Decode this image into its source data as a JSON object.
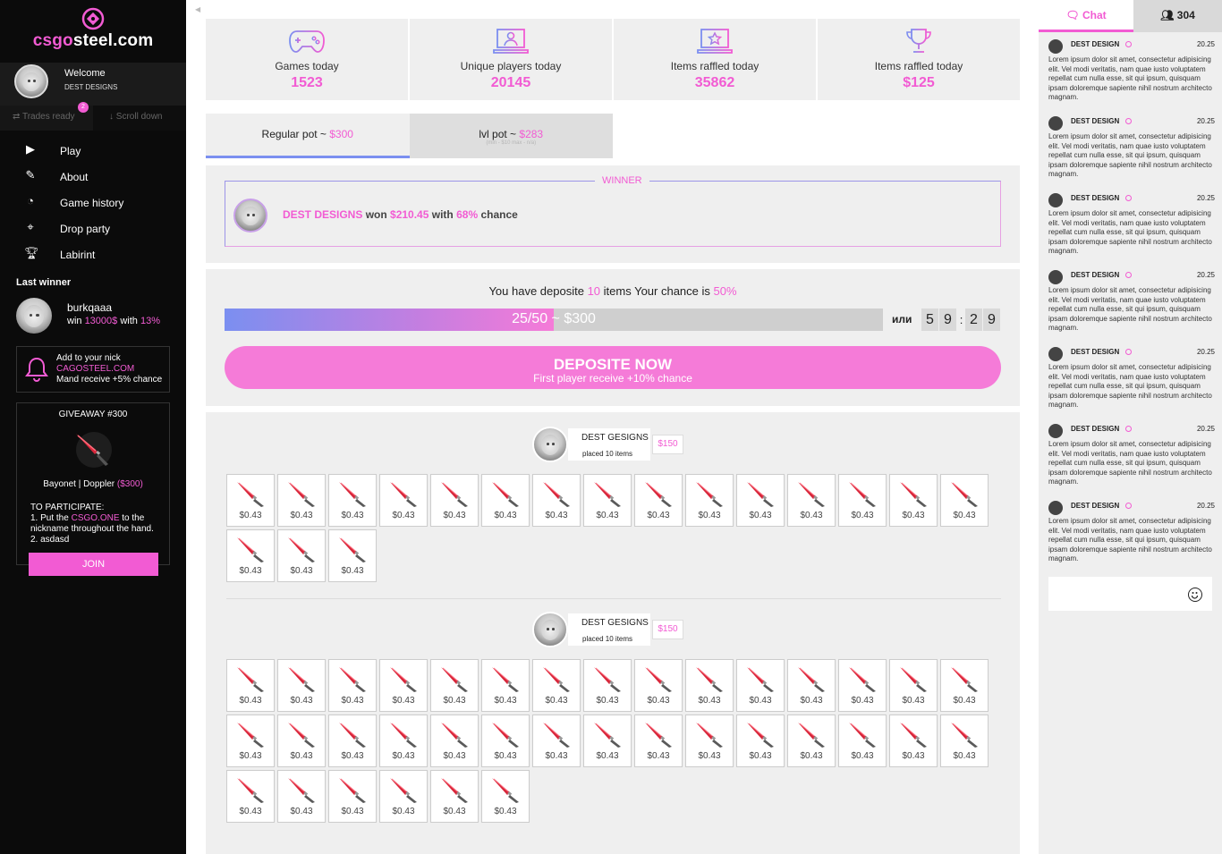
{
  "sidebar": {
    "logo": {
      "pre": "csgo",
      "post": "steel.com"
    },
    "welcome": "Welcome",
    "username": "DEST DESIGNS",
    "tab_trades": "Trades ready",
    "trades_count": "2",
    "tab_scroll": "Scroll down",
    "nav": [
      {
        "label": "Play",
        "icon": "play-icon"
      },
      {
        "label": "About",
        "icon": "edit-icon"
      },
      {
        "label": "Game history",
        "icon": "clock-icon"
      },
      {
        "label": "Drop party",
        "icon": "crosshair-icon"
      },
      {
        "label": "Labirint",
        "icon": "trophy-icon"
      }
    ],
    "last_winner": {
      "title": "Last winner",
      "name": "burkqaaa",
      "win_pre": "win ",
      "amount": "13000$",
      "with": " with ",
      "chance": "13%"
    },
    "promo": {
      "line1": "Add to your nick",
      "site": "CAGOSTEEL.COM",
      "line3": "Mand receive +5% chance"
    },
    "giveaway": {
      "title": "GIVEAWAY #300",
      "item": "Bayonet | Doppler ",
      "price": "($300)",
      "participate": "TO PARTICIPATE:",
      "step1_pre": "1. Put the ",
      "step1_site": "CSGO.ONE",
      "step1_post": " to the nickname throughout the hand.",
      "step2": "2. asdasd",
      "join": "JOIN"
    }
  },
  "stats": [
    {
      "label": "Games today",
      "value": "1523",
      "icon": "gamepad-icon"
    },
    {
      "label": "Unique players today",
      "value": "20145",
      "icon": "user-screen-icon"
    },
    {
      "label": "Items raffled today",
      "value": "35862",
      "icon": "star-screen-icon"
    },
    {
      "label": "Items raffled today",
      "value": "$125",
      "icon": "trophy-icon"
    }
  ],
  "pots": {
    "regular_label": "Regular pot ~ ",
    "regular_value": "$300",
    "lvl_label": "lvl pot ~ ",
    "lvl_value": "$283",
    "lvl_sub": "(min - $10 max - n/a)"
  },
  "winner": {
    "label": "WINNER",
    "name": "DEST DESIGNS",
    "won": " won ",
    "amount": "$210.45",
    "with": " with ",
    "chance": "68%",
    "suffix": " chance"
  },
  "deposit": {
    "pre": "You have deposite ",
    "count": "10",
    "mid": " items Your chance is ",
    "chance": "50%",
    "progress_text": "25/50 ~ $300",
    "progress": 0.5,
    "or": "или",
    "timer": [
      "5",
      "9",
      "2",
      "9"
    ],
    "timer_sep": ":",
    "button": "DEPOSITE NOW",
    "button_sub": "First player receive +10% chance"
  },
  "players": [
    {
      "name": "DEST GESIGNS",
      "placed": "placed 10 items",
      "price": "$150",
      "items": [
        "$0.43",
        "$0.43",
        "$0.43",
        "$0.43",
        "$0.43",
        "$0.43",
        "$0.43",
        "$0.43",
        "$0.43",
        "$0.43",
        "$0.43",
        "$0.43",
        "$0.43",
        "$0.43",
        "$0.43",
        "$0.43",
        "$0.43",
        "$0.43"
      ]
    },
    {
      "name": "DEST GESIGNS",
      "placed": "placed 10 items",
      "price": "$150",
      "items": [
        "$0.43",
        "$0.43",
        "$0.43",
        "$0.43",
        "$0.43",
        "$0.43",
        "$0.43",
        "$0.43",
        "$0.43",
        "$0.43",
        "$0.43",
        "$0.43",
        "$0.43",
        "$0.43",
        "$0.43",
        "$0.43",
        "$0.43",
        "$0.43",
        "$0.43",
        "$0.43",
        "$0.43",
        "$0.43",
        "$0.43",
        "$0.43",
        "$0.43",
        "$0.43",
        "$0.43",
        "$0.43",
        "$0.43",
        "$0.43",
        "$0.43",
        "$0.43",
        "$0.43",
        "$0.43",
        "$0.43",
        "$0.43"
      ]
    }
  ],
  "chat": {
    "tab_chat": "Chat",
    "online": "304",
    "messages": [
      {
        "name": "DEST DESIGN",
        "time": "20.25",
        "text": "Lorem ipsum dolor sit amet, consectetur adipisicing elit. Vel modi veritatis, nam quae iusto voluptatem repellat cum nulla esse, sit qui ipsum, quisquam ipsam doloremque sapiente nihil nostrum architecto magnam."
      },
      {
        "name": "DEST DESIGN",
        "time": "20.25",
        "text": "Lorem ipsum dolor sit amet, consectetur adipisicing elit. Vel modi veritatis, nam quae iusto voluptatem repellat cum nulla esse, sit qui ipsum, quisquam ipsam doloremque sapiente nihil nostrum architecto magnam."
      },
      {
        "name": "DEST DESIGN",
        "time": "20.25",
        "text": "Lorem ipsum dolor sit amet, consectetur adipisicing elit. Vel modi veritatis, nam quae iusto voluptatem repellat cum nulla esse, sit qui ipsum, quisquam ipsam doloremque sapiente nihil nostrum architecto magnam."
      },
      {
        "name": "DEST DESIGN",
        "time": "20.25",
        "text": "Lorem ipsum dolor sit amet, consectetur adipisicing elit. Vel modi veritatis, nam quae iusto voluptatem repellat cum nulla esse, sit qui ipsum, quisquam ipsam doloremque sapiente nihil nostrum architecto magnam."
      },
      {
        "name": "DEST DESIGN",
        "time": "20.25",
        "text": "Lorem ipsum dolor sit amet, consectetur adipisicing elit. Vel modi veritatis, nam quae iusto voluptatem repellat cum nulla esse, sit qui ipsum, quisquam ipsam doloremque sapiente nihil nostrum architecto magnam."
      },
      {
        "name": "DEST DESIGN",
        "time": "20.25",
        "text": "Lorem ipsum dolor sit amet, consectetur adipisicing elit. Vel modi veritatis, nam quae iusto voluptatem repellat cum nulla esse, sit qui ipsum, quisquam ipsam doloremque sapiente nihil nostrum architecto magnam."
      },
      {
        "name": "DEST DESIGN",
        "time": "20.25",
        "text": "Lorem ipsum dolor sit amet, consectetur adipisicing elit. Vel modi veritatis, nam quae iusto voluptatem repellat cum nulla esse, sit qui ipsum, quisquam ipsam doloremque sapiente nihil nostrum architecto magnam."
      }
    ],
    "input_placeholder": ""
  },
  "colors": {
    "accent": "#f25bd3",
    "accent2": "#7b8ff0",
    "sidebar": "#0b0b0b",
    "panel": "#efefef"
  }
}
